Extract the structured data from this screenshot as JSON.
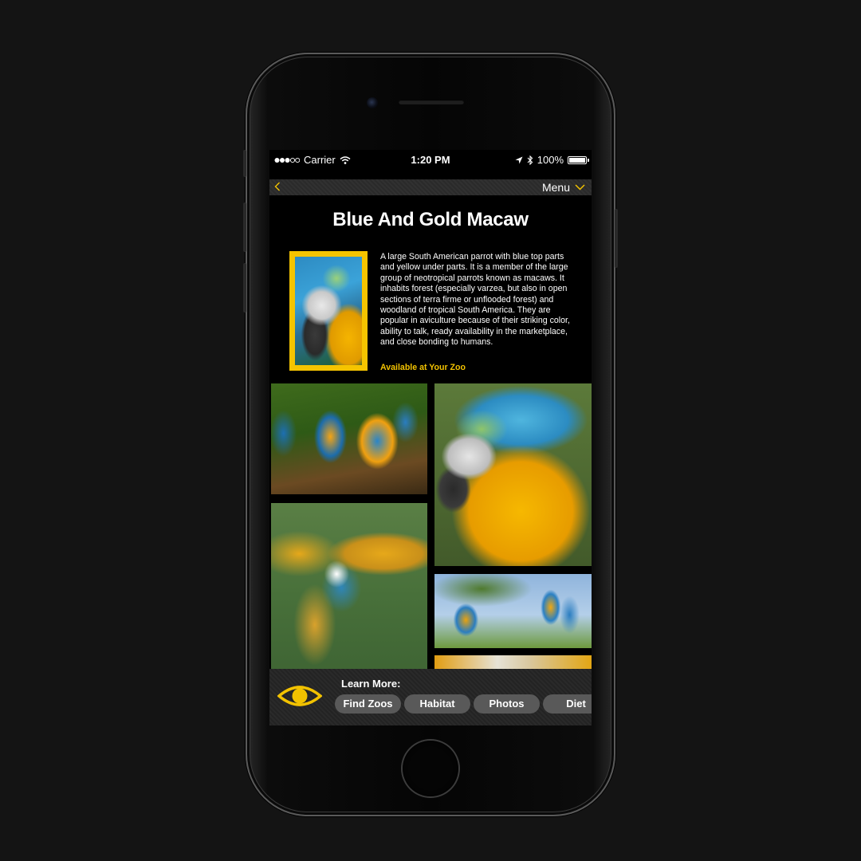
{
  "status_bar": {
    "carrier": "Carrier",
    "time": "1:20 PM",
    "battery": "100%",
    "battery_level": 1.0
  },
  "nav": {
    "back_icon": "chevron-left-icon",
    "menu_label": "Menu"
  },
  "animal": {
    "title": "Blue And Gold Macaw",
    "description": "A large South American parrot with blue top parts and yellow under parts. It is a member of the large group of neotropical parrots known as macaws. It inhabits forest (especially varzea, but also in open sections of terra firme or unflooded forest) and woodland of tropical South America. They are popular in aviculture because of their striking color, ability to talk, ready availability in the marketplace, and close bonding to humans.",
    "availability": "Available at Your Zoo"
  },
  "learn_more": {
    "heading": "Learn More:",
    "buttons": [
      "Find Zoos",
      "Habitat",
      "Photos",
      "Diet"
    ]
  },
  "colors": {
    "accent": "#f2c200",
    "background": "#000000",
    "pill": "#595959"
  }
}
